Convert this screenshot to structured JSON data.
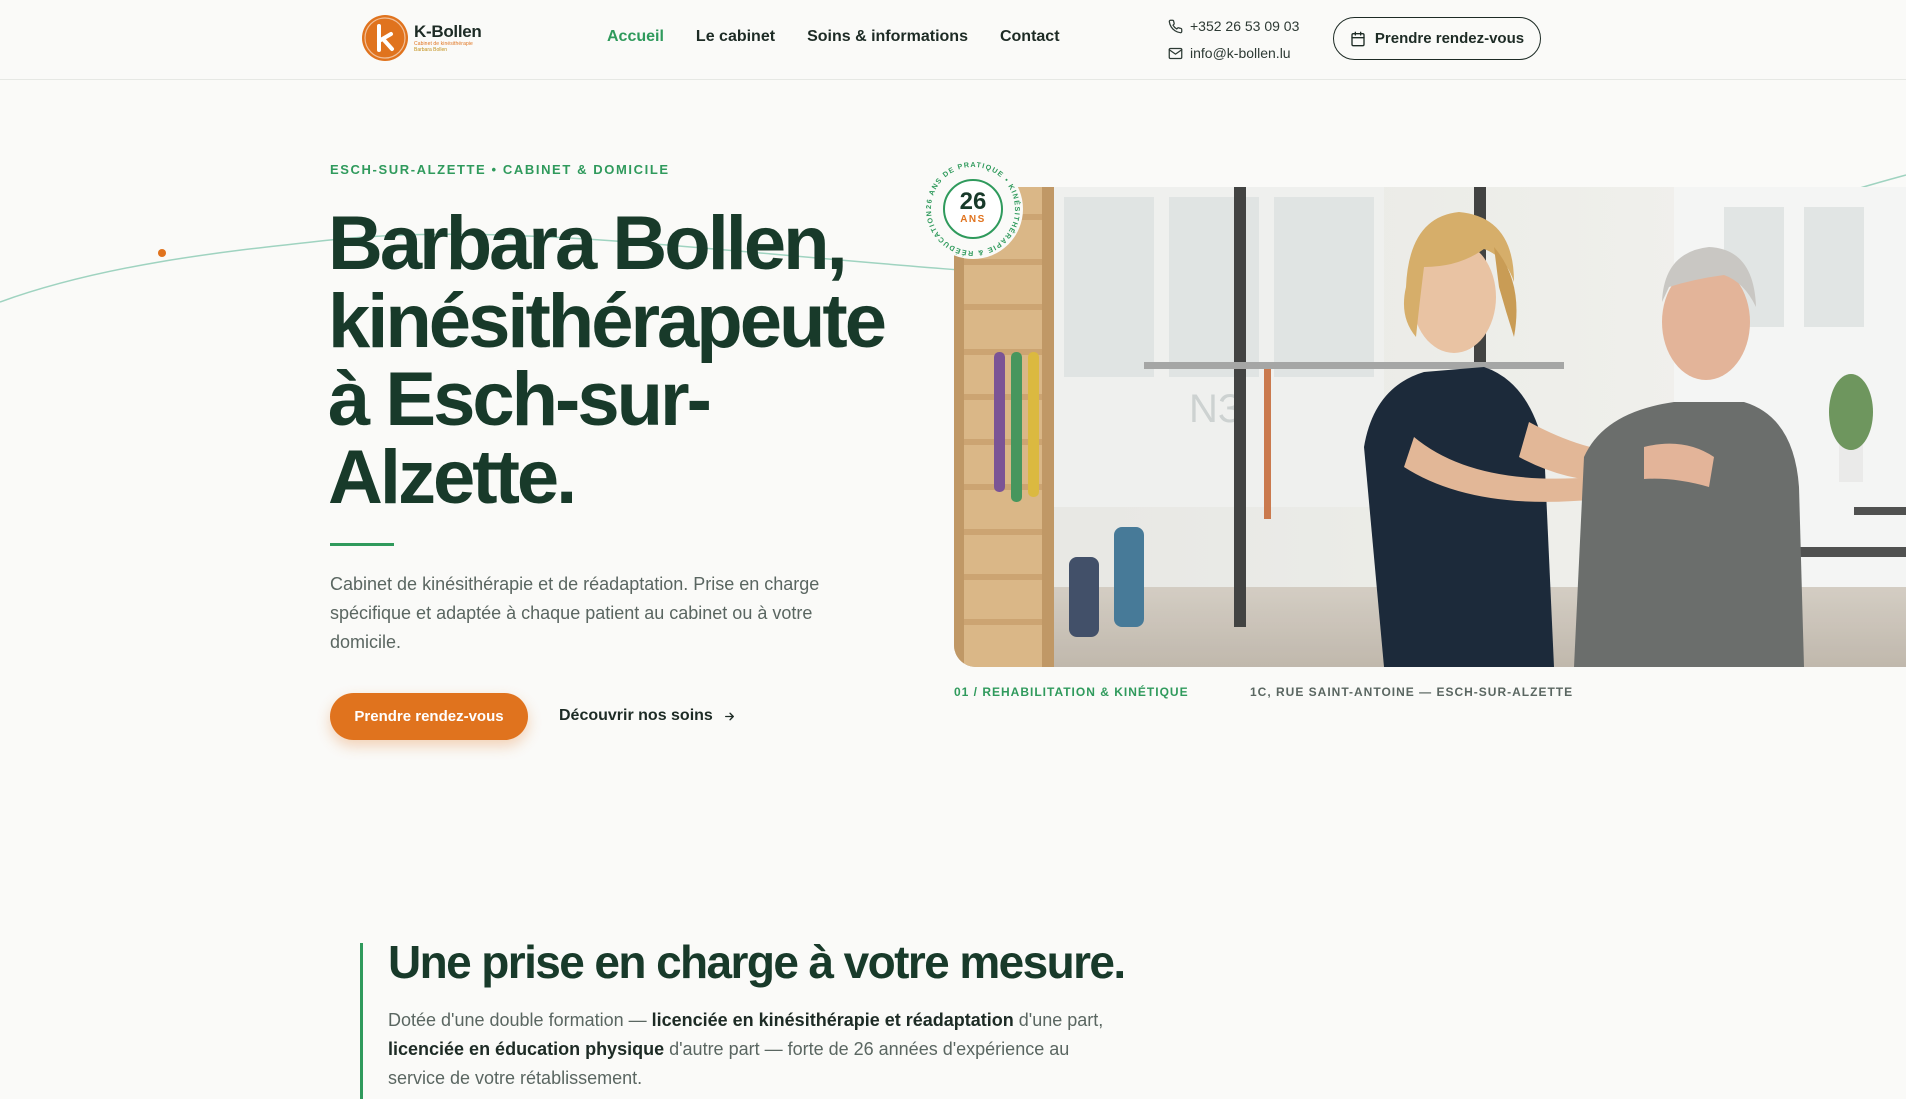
{
  "header": {
    "logo": {
      "name": "K-Bollen",
      "tagline": "Cabinet de kinésithérapie",
      "tagline2": "Barbara Bollen"
    },
    "nav": [
      {
        "label": "Accueil",
        "active": true
      },
      {
        "label": "Le cabinet",
        "active": false
      },
      {
        "label": "Soins & informations",
        "active": false
      },
      {
        "label": "Contact",
        "active": false
      }
    ],
    "phone": "+352 26 53 09 03",
    "email": "info@k-bollen.lu",
    "cta_label": "Prendre rendez-vous"
  },
  "hero": {
    "eyebrow": "ESCH-SUR-ALZETTE • CABINET & DOMICILE",
    "title_lines": [
      "Barbara Bollen,",
      "kinésithérapeute",
      "à Esch-sur-",
      "Alzette."
    ],
    "description": "Cabinet de kinésithérapie et de réadaptation. Prise en charge spécifique et adaptée à chaque patient au cabinet ou à votre domicile.",
    "primary_cta": "Prendre rendez-vous",
    "secondary_link": "Découvrir nos soins",
    "badge": {
      "number": "26",
      "unit": "ANS",
      "ring_text": "26 ANS DE PRATIQUE • KINÉSITHÉRAPIE & RÉÉDUCATION •"
    },
    "caption_left": "01 / REHABILITATION & KINÉTIQUE",
    "caption_right": "1C, RUE SAINT-ANTOINE — ESCH-SUR-ALZETTE"
  },
  "section": {
    "title": "Une prise en charge à votre mesure.",
    "text_parts": [
      "Dotée d'une double formation — ",
      "licenciée en kinésithérapie et réadaptation",
      " d'une part, ",
      "licenciée en éducation physique",
      " d'autre part — forte de 26 années d'expérience au service de votre rétablissement."
    ]
  },
  "colors": {
    "accent_green": "#2f9a5c",
    "accent_orange": "#e0731e",
    "dark_green": "#183a2a"
  }
}
